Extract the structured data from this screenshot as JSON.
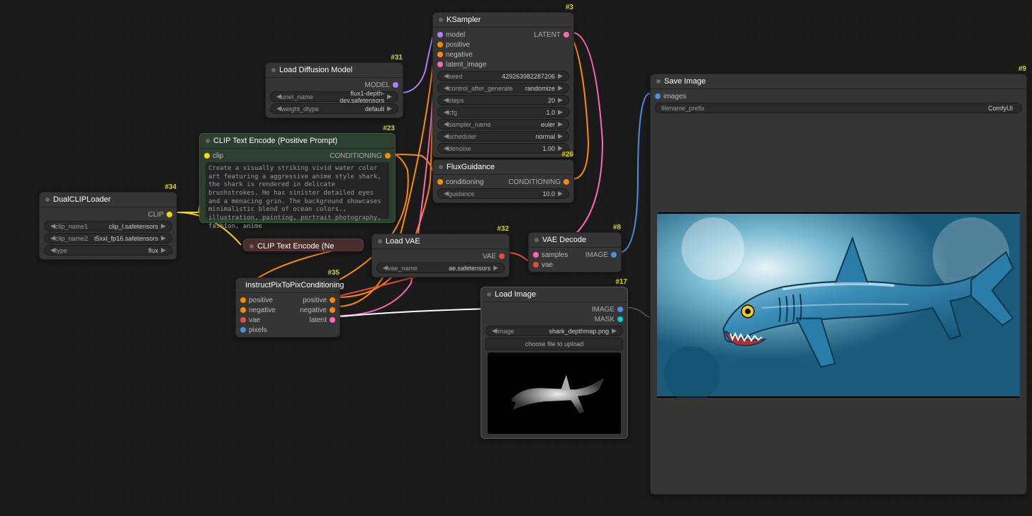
{
  "nodes": {
    "dualclip": {
      "id": "#34",
      "title": "DualCLIPLoader",
      "clip_out": "CLIP",
      "w_clip1": {
        "l": "clip_name1",
        "v": "clip_l.safetensors"
      },
      "w_clip2": {
        "l": "clip_name2",
        "v": "t5xxl_fp16.safetensors"
      },
      "w_type": {
        "l": "type",
        "v": "flux"
      }
    },
    "loaddiff": {
      "id": "#31",
      "title": "Load Diffusion Model",
      "model_out": "MODEL",
      "w_unet": {
        "l": "unet_name",
        "v": "flux1-depth-dev.safetensors"
      },
      "w_dtype": {
        "l": "weight_dtype",
        "v": "default"
      }
    },
    "clippos": {
      "id": "#23",
      "title": "CLIP Text Encode (Positive Prompt)",
      "clip_in": "clip",
      "cond_out": "CONDITIONING",
      "text": "Create a visually striking vivid water color art featuring a aggressive anime style shark, the shark is rendered in delicate brushstrokes. He has sinister detailed eyes and a menacing grin. The background showcases minimalistic blend of ocean colors., illustration, painting, portrait photography, fashion, anime"
    },
    "clipneg": {
      "id": "#7",
      "title": "CLIP Text Encode (Ne"
    },
    "ksampler": {
      "id": "#3",
      "title": "KSampler",
      "model": "model",
      "positive": "positive",
      "negative": "negative",
      "latent_image": "latent_image",
      "latent_out": "LATENT",
      "w_seed": {
        "l": "seed",
        "v": "429263982287206"
      },
      "w_ctrl": {
        "l": "control_after_generate",
        "v": "randomize"
      },
      "w_steps": {
        "l": "steps",
        "v": "20"
      },
      "w_cfg": {
        "l": "cfg",
        "v": "1.0"
      },
      "w_sampler": {
        "l": "sampler_name",
        "v": "euler"
      },
      "w_sched": {
        "l": "scheduler",
        "v": "normal"
      },
      "w_denoise": {
        "l": "denoise",
        "v": "1.00"
      }
    },
    "fluxguid": {
      "id": "#26",
      "title": "FluxGuidance",
      "cond_in": "conditioning",
      "cond_out": "CONDITIONING",
      "w_guid": {
        "l": "guidance",
        "v": "10.0"
      }
    },
    "loadvae": {
      "id": "#32",
      "title": "Load VAE",
      "vae_out": "VAE",
      "w_vae": {
        "l": "vae_name",
        "v": "ae.safetensors"
      }
    },
    "vaedecode": {
      "id": "#8",
      "title": "VAE Decode",
      "samples": "samples",
      "vae": "vae",
      "image_out": "IMAGE"
    },
    "instruct": {
      "id": "#35",
      "title": "InstructPixToPixConditioning",
      "pos_in": "positive",
      "neg_in": "negative",
      "vae_in": "vae",
      "pix_in": "pixels",
      "pos_out": "positive",
      "neg_out": "negative",
      "latent_out": "latent"
    },
    "loadimg": {
      "id": "#17",
      "title": "Load Image",
      "image_out": "IMAGE",
      "mask_out": "MASK",
      "w_image": {
        "l": "image",
        "v": "shark_depthmap.png"
      },
      "upload": "choose file to upload"
    },
    "saveimg": {
      "id": "#9",
      "title": "Save Image",
      "images": "images",
      "w_prefix": {
        "l": "filename_prefix",
        "v": "ComfyUI"
      }
    }
  }
}
